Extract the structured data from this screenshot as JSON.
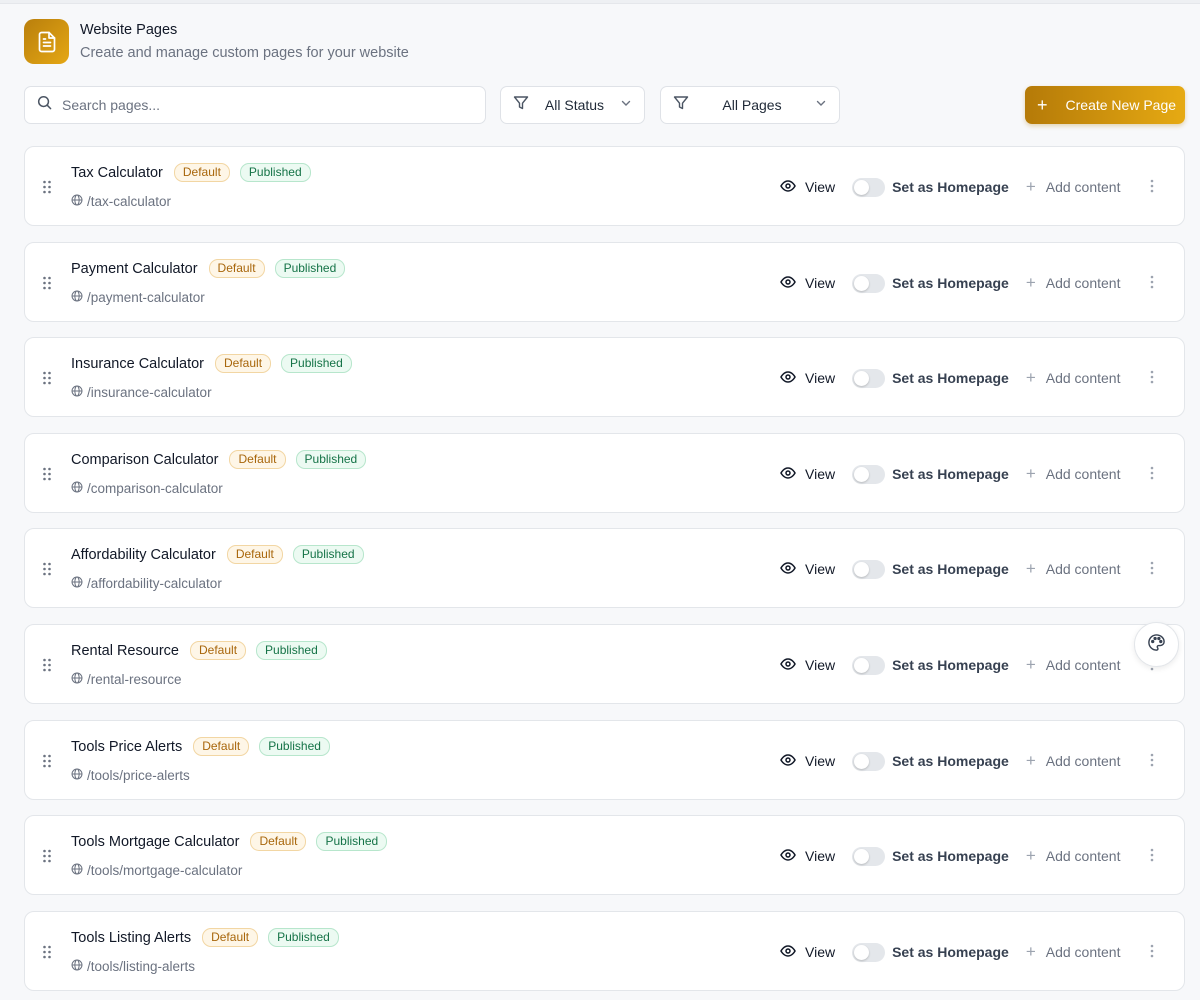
{
  "header": {
    "title": "Website Pages",
    "subtitle": "Create and manage custom pages for your website",
    "icon": "document-icon"
  },
  "toolbar": {
    "search_placeholder": "Search pages...",
    "search_value": "",
    "status_filter": "All Status",
    "pages_filter": "All Pages",
    "create_label": "Create New Page"
  },
  "row_actions": {
    "view_label": "View",
    "homepage_label": "Set as Homepage",
    "add_label": "Add content"
  },
  "pages": [
    {
      "name": "Tax Calculator",
      "badge_default": "Default",
      "badge_status": "Published",
      "slug": "/tax-calculator",
      "is_homepage": false
    },
    {
      "name": "Payment Calculator",
      "badge_default": "Default",
      "badge_status": "Published",
      "slug": "/payment-calculator",
      "is_homepage": false
    },
    {
      "name": "Insurance Calculator",
      "badge_default": "Default",
      "badge_status": "Published",
      "slug": "/insurance-calculator",
      "is_homepage": false
    },
    {
      "name": "Comparison Calculator",
      "badge_default": "Default",
      "badge_status": "Published",
      "slug": "/comparison-calculator",
      "is_homepage": false
    },
    {
      "name": "Affordability Calculator",
      "badge_default": "Default",
      "badge_status": "Published",
      "slug": "/affordability-calculator",
      "is_homepage": false
    },
    {
      "name": "Rental Resource",
      "badge_default": "Default",
      "badge_status": "Published",
      "slug": "/rental-resource",
      "is_homepage": false
    },
    {
      "name": "Tools Price Alerts",
      "badge_default": "Default",
      "badge_status": "Published",
      "slug": "/tools/price-alerts",
      "is_homepage": false
    },
    {
      "name": "Tools Mortgage Calculator",
      "badge_default": "Default",
      "badge_status": "Published",
      "slug": "/tools/mortgage-calculator",
      "is_homepage": false
    },
    {
      "name": "Tools Listing Alerts",
      "badge_default": "Default",
      "badge_status": "Published",
      "slug": "/tools/listing-alerts",
      "is_homepage": false
    }
  ],
  "colors": {
    "accent_start": "#b57a08",
    "accent_end": "#e6aa13",
    "default_badge": "#a8660b",
    "published_badge": "#157347"
  }
}
